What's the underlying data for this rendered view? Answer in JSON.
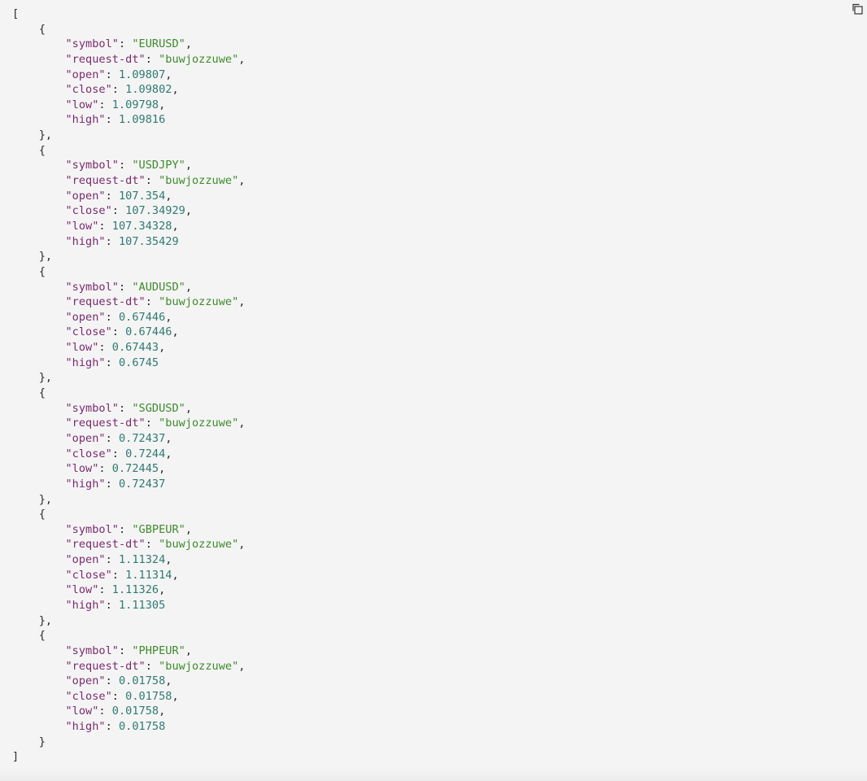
{
  "toolbar": {
    "copy_icon": "copy-icon"
  },
  "json": {
    "open_bracket": "[",
    "close_bracket": "]",
    "records": [
      {
        "symbol": "EURUSD",
        "request_dt": "buwjozzuwe",
        "open": "1.09807",
        "close": "1.09802",
        "low": "1.09798",
        "high": "1.09816"
      },
      {
        "symbol": "USDJPY",
        "request_dt": "buwjozzuwe",
        "open": "107.354",
        "close": "107.34929",
        "low": "107.34328",
        "high": "107.35429"
      },
      {
        "symbol": "AUDUSD",
        "request_dt": "buwjozzuwe",
        "open": "0.67446",
        "close": "0.67446",
        "low": "0.67443",
        "high": "0.6745"
      },
      {
        "symbol": "SGDUSD",
        "request_dt": "buwjozzuwe",
        "open": "0.72437",
        "close": "0.7244",
        "low": "0.72445",
        "high": "0.72437"
      },
      {
        "symbol": "GBPEUR",
        "request_dt": "buwjozzuwe",
        "open": "1.11324",
        "close": "1.11314",
        "low": "1.11326",
        "high": "1.11305"
      },
      {
        "symbol": "PHPEUR",
        "request_dt": "buwjozzuwe",
        "open": "0.01758",
        "close": "0.01758",
        "low": "0.01758",
        "high": "0.01758"
      }
    ],
    "key_labels": {
      "symbol": "\"symbol\"",
      "request_dt": "\"request-dt\"",
      "open": "\"open\"",
      "close": "\"close\"",
      "low": "\"low\"",
      "high": "\"high\""
    }
  }
}
